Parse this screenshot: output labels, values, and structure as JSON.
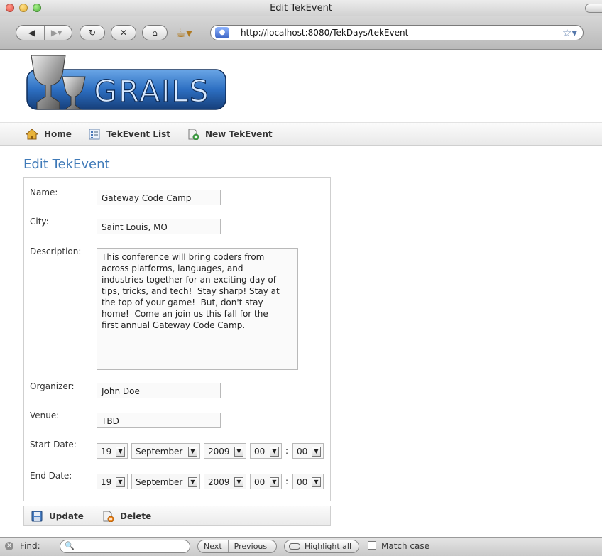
{
  "window": {
    "title": "Edit TekEvent"
  },
  "browser": {
    "url": "http://localhost:8080/TekDays/tekEvent"
  },
  "logo": {
    "text": "GRAILS"
  },
  "nav": {
    "items": [
      {
        "label": "Home",
        "icon": "home-icon"
      },
      {
        "label": "TekEvent List",
        "icon": "list-icon"
      },
      {
        "label": "New TekEvent",
        "icon": "new-doc-icon"
      }
    ]
  },
  "page": {
    "title": "Edit TekEvent",
    "title_color": "#3f7ab8"
  },
  "form": {
    "name_label": "Name:",
    "name_value": "Gateway Code Camp",
    "city_label": "City:",
    "city_value": "Saint Louis, MO",
    "description_label": "Description:",
    "description_value": "This conference will bring coders from\nacross platforms, languages, and\nindustries together for an exciting day of\ntips, tricks, and tech!  Stay sharp! Stay at\nthe top of your game!  But, don't stay\nhome!  Come an join us this fall for the\nfirst annual Gateway Code Camp.",
    "organizer_label": "Organizer:",
    "organizer_value": "John Doe",
    "venue_label": "Venue:",
    "venue_value": "TBD",
    "start_label": "Start Date:",
    "start": {
      "day": "19",
      "month": "September",
      "year": "2009",
      "hour": "00",
      "minute": "00"
    },
    "end_label": "End Date:",
    "end": {
      "day": "19",
      "month": "September",
      "year": "2009",
      "hour": "00",
      "minute": "00"
    },
    "time_separator": ":"
  },
  "buttons": {
    "update": "Update",
    "delete": "Delete"
  },
  "findbar": {
    "label": "Find:",
    "query": "",
    "next": "Next",
    "previous": "Previous",
    "highlight_all": "Highlight all",
    "match_case": "Match case"
  }
}
